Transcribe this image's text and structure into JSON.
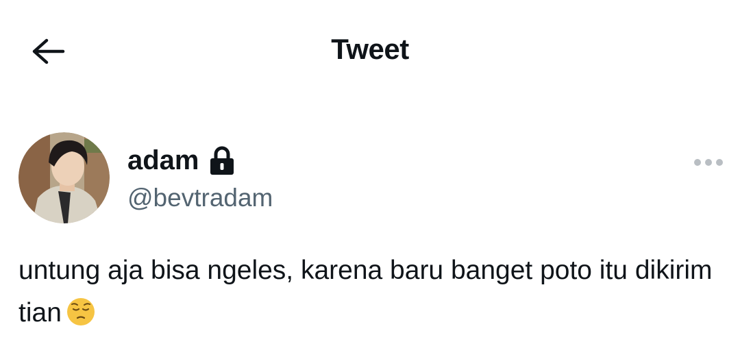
{
  "header": {
    "title": "Tweet",
    "back_icon": "arrow-left-icon"
  },
  "author": {
    "display_name": "adam",
    "handle": "@bevtradam",
    "protected_icon": "lock-icon",
    "avatar": "profile-photo"
  },
  "tweet": {
    "text": "untung aja bisa ngeles, karena baru banget poto itu dikirim tian",
    "emoji": "pensive-face-emoji"
  },
  "more_icon": "more-horizontal-icon",
  "colors": {
    "text_primary": "#0f1419",
    "text_secondary": "#536471",
    "icon_muted": "#b9bec3",
    "background": "#ffffff"
  }
}
